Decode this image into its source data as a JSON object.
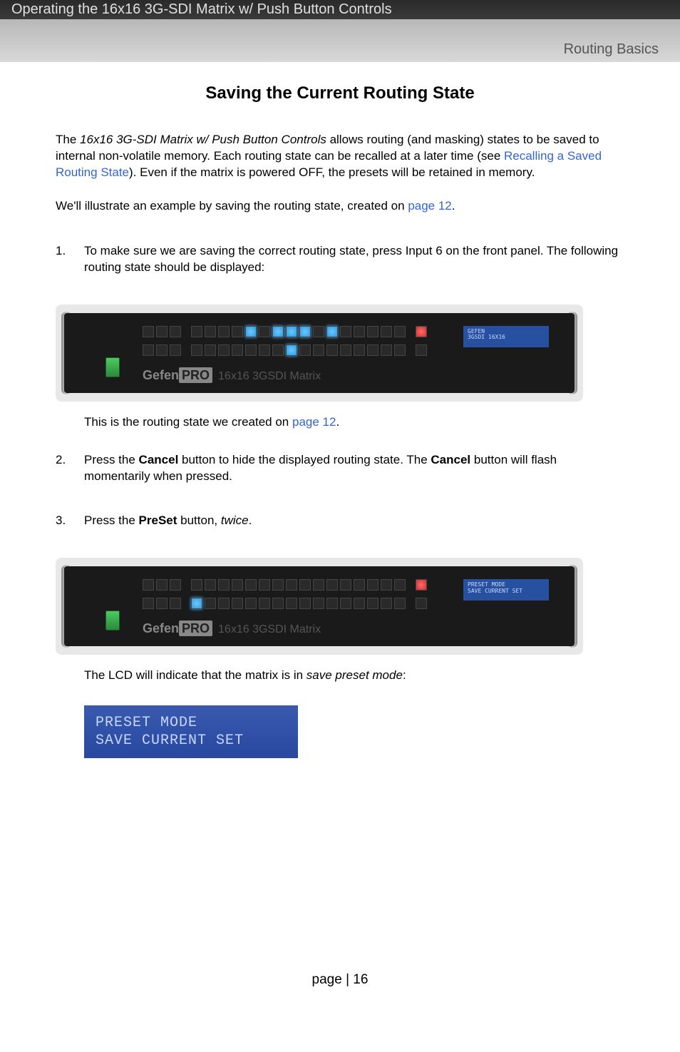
{
  "header": {
    "title": "Operating the 16x16 3G-SDI Matrix w/ Push Button Controls",
    "section": "Routing Basics"
  },
  "main": {
    "heading": "Saving the Current Routing State",
    "intro_pre": "The ",
    "intro_product": "16x16 3G-SDI Matrix w/ Push Button Controls",
    "intro_mid": " allows routing (and masking) states to be saved to internal non-volatile memory.  Each routing state can be recalled at a later time (see ",
    "intro_link": "Recalling a Saved Routing State",
    "intro_post": ").  Even if the matrix is powered OFF, the presets will be retained in memory.",
    "example_pre": "We'll illustrate an example by saving the routing state, created on ",
    "example_link": "page 12",
    "example_post": "."
  },
  "steps": [
    {
      "num": "1.",
      "text": "To make sure we are saving the correct routing state, press Input 6 on the front panel.  The following routing state should be displayed:"
    },
    {
      "num": "2.",
      "text_pre": "Press the ",
      "b1": "Cancel",
      "text_mid": " button to hide the displayed routing state.  The ",
      "b2": "Cancel",
      "text_post": " button will flash momentarily when pressed."
    },
    {
      "num": "3.",
      "text_pre": "Press the ",
      "b1": "PreSet",
      "text_mid": " button, ",
      "i1": "twice",
      "text_post": "."
    }
  ],
  "after_img1_pre": "This is the routing state we created on ",
  "after_img1_link": "page 12",
  "after_img1_post": ".",
  "after_img2_pre": "The LCD will indicate that the matrix is in ",
  "after_img2_i": "save preset mode",
  "after_img2_post": ":",
  "device1": {
    "lcd_line1": "GEFEN",
    "lcd_line2": "3GSDI 16X16",
    "brand": "Gefen",
    "brand_pro": "PRO",
    "brand_sub": "16x16 3GSDI Matrix",
    "top_lit": [
      5,
      7,
      8,
      9,
      11
    ],
    "bot_lit": [
      8
    ]
  },
  "device2": {
    "lcd_line1": "PRESET MODE",
    "lcd_line2": "SAVE CURRENT SET",
    "brand": "Gefen",
    "brand_pro": "PRO",
    "brand_sub": "16x16 3GSDI Matrix",
    "top_lit": [],
    "bot_lit_blue": [
      1
    ]
  },
  "lcd": {
    "line1": "PRESET MODE",
    "line2": "SAVE CURRENT SET"
  },
  "footer": {
    "page": "page | 16"
  }
}
